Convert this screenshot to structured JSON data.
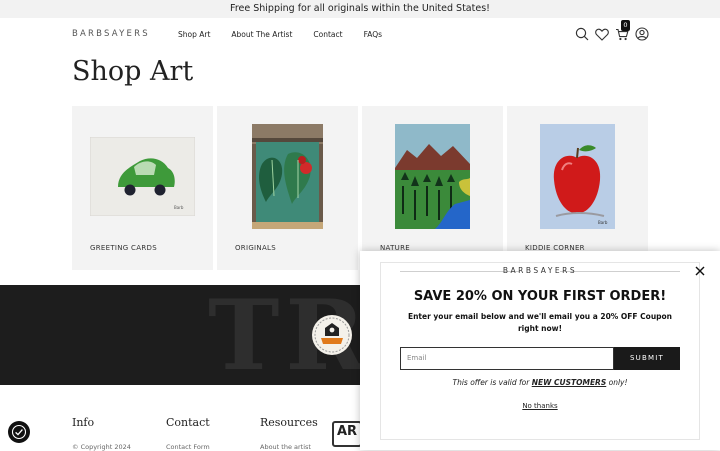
{
  "announcement": "Free Shipping for all originals within the United States!",
  "header": {
    "logo": "BARBSAYERS",
    "nav": [
      "Shop Art",
      "About The Artist",
      "Contact",
      "FAQs"
    ],
    "cart_count": "0",
    "icons": [
      "search-icon",
      "heart-icon",
      "cart-icon",
      "account-icon"
    ]
  },
  "page_title": "Shop Art",
  "categories": [
    {
      "label": "GREETING CARDS"
    },
    {
      "label": "ORIGINALS"
    },
    {
      "label": "NATURE"
    },
    {
      "label": "KIDDIE CORNER"
    }
  ],
  "banner_text": "TR",
  "footer": {
    "columns": [
      {
        "heading": "Info",
        "link": "© Copyright 2024"
      },
      {
        "heading": "Contact",
        "link": "Contact Form"
      },
      {
        "heading": "Resources",
        "link": "About the artist"
      }
    ],
    "ar_logo": "AR"
  },
  "popup": {
    "brand": "BARBSAYERS",
    "headline": "SAVE 20% ON YOUR FIRST ORDER!",
    "subtext": "Enter your email below and we'll email you a 20% OFF Coupon right now!",
    "email_placeholder": "Email",
    "submit_label": "SUBMIT",
    "offer_prefix": "This offer is valid for ",
    "offer_emphasis": "NEW CUSTOMERS",
    "offer_suffix": " only!",
    "decline_label": "No thanks"
  },
  "colors": {
    "dark_band": "#1d1d1d",
    "card_bg": "#f3f3f3",
    "button": "#1a1a1a"
  }
}
